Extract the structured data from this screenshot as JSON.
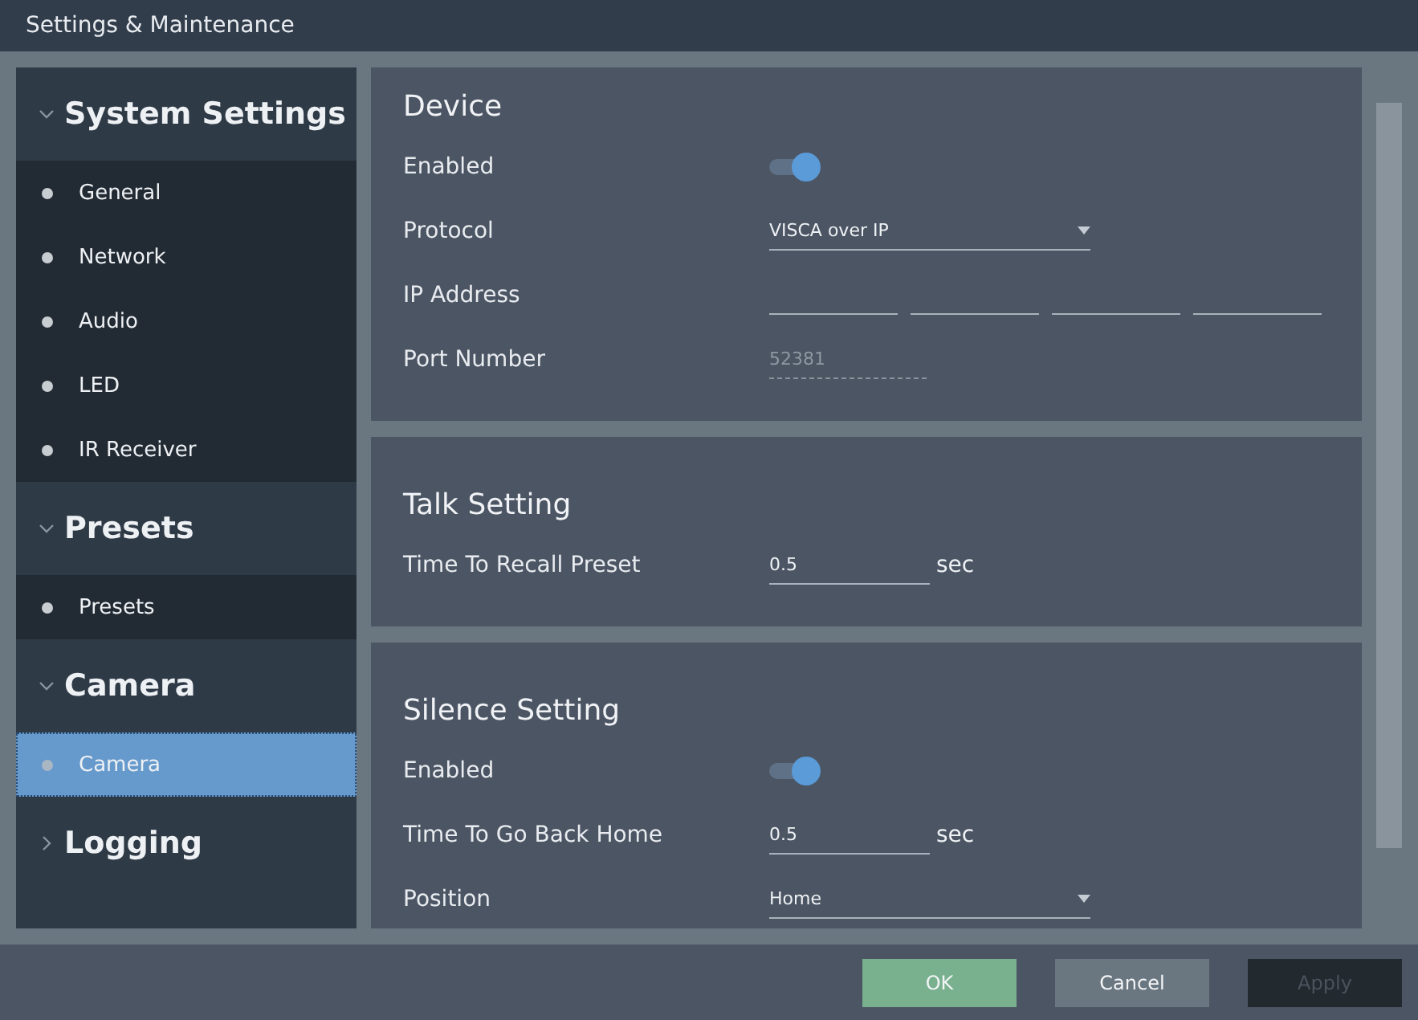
{
  "window": {
    "title": "Settings & Maintenance"
  },
  "sidebar": {
    "groups": [
      {
        "label": "System Settings",
        "expanded": true,
        "items": [
          {
            "label": "General",
            "selected": false
          },
          {
            "label": "Network",
            "selected": false
          },
          {
            "label": "Audio",
            "selected": false
          },
          {
            "label": "LED",
            "selected": false
          },
          {
            "label": "IR Receiver",
            "selected": false
          }
        ]
      },
      {
        "label": "Presets",
        "expanded": true,
        "items": [
          {
            "label": "Presets",
            "selected": false
          }
        ]
      },
      {
        "label": "Camera",
        "expanded": true,
        "items": [
          {
            "label": "Camera",
            "selected": true
          }
        ]
      },
      {
        "label": "Logging",
        "expanded": false
      }
    ]
  },
  "sections": [
    {
      "title": "Device",
      "fields": [
        {
          "kind": "toggle",
          "label": "Enabled",
          "on": true
        },
        {
          "kind": "select",
          "label": "Protocol",
          "value": "VISCA over IP"
        },
        {
          "kind": "ip",
          "label": "IP Address"
        },
        {
          "kind": "number",
          "label": "Port Number",
          "value": "52381",
          "disabled": true
        }
      ]
    },
    {
      "title": "Talk Setting",
      "fields": [
        {
          "kind": "number",
          "label": "Time To Recall Preset",
          "value": "0.5",
          "unit": "sec",
          "disabled": false
        }
      ]
    },
    {
      "title": "Silence Setting",
      "fields": [
        {
          "kind": "toggle",
          "label": "Enabled",
          "on": true
        },
        {
          "kind": "number",
          "label": "Time To Go Back Home",
          "value": "0.5",
          "unit": "sec",
          "disabled": false
        },
        {
          "kind": "select",
          "label": "Position",
          "value": "Home"
        }
      ]
    }
  ],
  "buttons": [
    {
      "label": "OK",
      "kind": "primary",
      "disabled": false
    },
    {
      "label": "Cancel",
      "kind": "secondary",
      "disabled": false
    },
    {
      "label": "Apply",
      "kind": "secondary",
      "disabled": true
    }
  ]
}
